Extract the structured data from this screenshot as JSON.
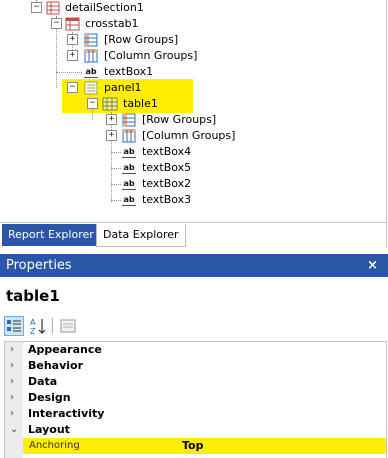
{
  "tree": {
    "detail_section": "detailSection1",
    "crosstab": "crosstab1",
    "crosstab_row_groups": "[Row Groups]",
    "crosstab_column_groups": "[Column Groups]",
    "textbox1": "textBox1",
    "panel": "panel1",
    "table": "table1",
    "table_row_groups": "[Row Groups]",
    "table_column_groups": "[Column Groups]",
    "textbox4": "textBox4",
    "textbox5": "textBox5",
    "textbox2": "textBox2",
    "textbox3": "textBox3",
    "ab_glyph": "ab"
  },
  "tabs": {
    "report_explorer": "Report Explorer",
    "data_explorer": "Data Explorer"
  },
  "properties": {
    "title": "Properties",
    "close_glyph": "×",
    "object_name": "table1",
    "categories": [
      {
        "label": "Appearance",
        "arrow": "›"
      },
      {
        "label": "Behavior",
        "arrow": "›"
      },
      {
        "label": "Data",
        "arrow": "›"
      },
      {
        "label": "Design",
        "arrow": "›"
      },
      {
        "label": "Interactivity",
        "arrow": "›"
      },
      {
        "label": "Layout",
        "arrow": "⌄"
      }
    ],
    "selected_property": {
      "name": "Anchoring",
      "value": "Top"
    }
  },
  "colors": {
    "accent": "#2b56a8",
    "highlight": "#ffee00"
  }
}
